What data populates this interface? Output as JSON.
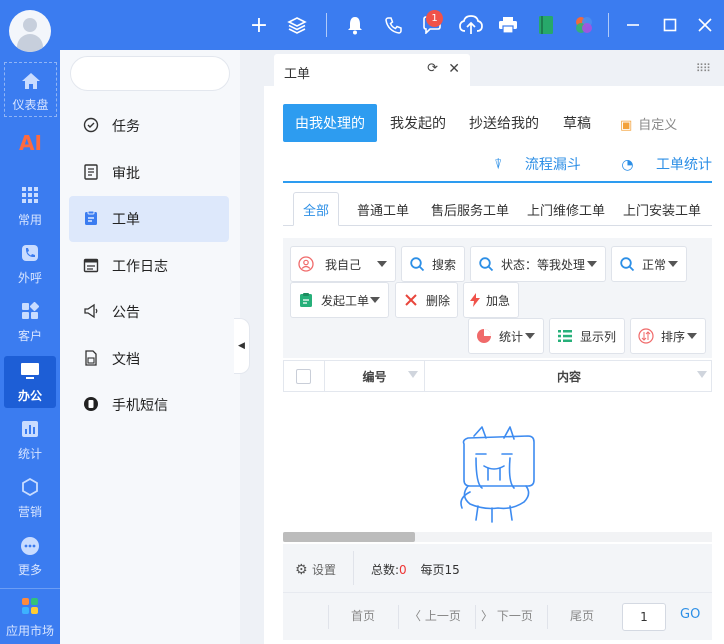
{
  "rail": {
    "items": [
      {
        "label": "仪表盘",
        "icon": "home-icon"
      },
      {
        "label": "",
        "icon": "ai-icon"
      },
      {
        "label": "常用",
        "icon": "apps-grid-icon"
      },
      {
        "label": "外呼",
        "icon": "phone-icon"
      },
      {
        "label": "客户",
        "icon": "customer-icon"
      },
      {
        "label": "办公",
        "icon": "monitor-icon"
      },
      {
        "label": "统计",
        "icon": "bar-chart-icon"
      },
      {
        "label": "营销",
        "icon": "hexagon-icon"
      },
      {
        "label": "更多",
        "icon": "more-icon"
      },
      {
        "label": "应用市场",
        "icon": "app-market-icon"
      }
    ],
    "ai_text": "AI"
  },
  "topbar": {
    "notification_count": "1"
  },
  "sidebar": {
    "items": [
      {
        "label": "任务",
        "icon": "clock-check-icon"
      },
      {
        "label": "审批",
        "icon": "approval-doc-icon"
      },
      {
        "label": "工单",
        "icon": "clipboard-icon"
      },
      {
        "label": "工作日志",
        "icon": "calendar-log-icon"
      },
      {
        "label": "公告",
        "icon": "megaphone-icon"
      },
      {
        "label": "文档",
        "icon": "document-icon"
      },
      {
        "label": "手机短信",
        "icon": "sms-icon"
      }
    ]
  },
  "tab": {
    "title": "工单"
  },
  "segments": [
    "由我处理的",
    "我发起的",
    "抄送给我的",
    "草稿"
  ],
  "custom_label": "自定义",
  "links": {
    "funnel": "流程漏斗",
    "stats": "工单统计"
  },
  "subtabs": [
    "全部",
    "普通工单",
    "售后服务工单",
    "上门维修工单",
    "上门安装工单"
  ],
  "toolbar": {
    "self": "我自己",
    "search": "搜索",
    "status": "状态：等我处理",
    "normal": "正常",
    "create": "发起工单",
    "delete": "删除",
    "urgent": "加急",
    "stats": "统计",
    "columns": "显示列",
    "sort": "排序"
  },
  "table": {
    "columns": [
      "编号",
      "内容"
    ]
  },
  "pager": {
    "settings": "设置",
    "total_label": "总数:",
    "total_value": "0",
    "per_page": "每页15",
    "first": "首页",
    "prev": "上一页",
    "next": "下一页",
    "last": "尾页",
    "page_input": "1",
    "go": "GO"
  },
  "colors": {
    "brand": "#3b7cf0",
    "accent": "#2d9cf0",
    "danger": "#f0524a"
  }
}
